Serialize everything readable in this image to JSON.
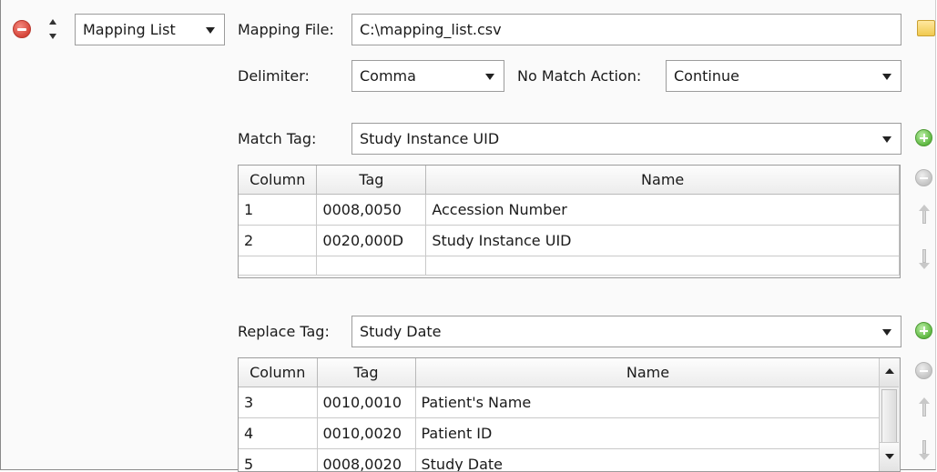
{
  "header": {
    "mode_select": {
      "value": "Mapping List"
    },
    "mapping_file_label": "Mapping File:",
    "mapping_file_value": "C:\\mapping_list.csv"
  },
  "delimiter": {
    "label": "Delimiter:",
    "value": "Comma",
    "no_match_label": "No Match Action:",
    "no_match_value": "Continue"
  },
  "match_tag": {
    "label": "Match Tag:",
    "value": "Study Instance UID",
    "table": {
      "columns": [
        "Column",
        "Tag",
        "Name"
      ],
      "rows": [
        [
          "1",
          "0008,0050",
          "Accession Number"
        ],
        [
          "2",
          "0020,000D",
          "Study Instance UID"
        ]
      ]
    }
  },
  "replace_tag": {
    "label": "Replace Tag:",
    "value": "Study Date",
    "table": {
      "columns": [
        "Column",
        "Tag",
        "Name"
      ],
      "rows": [
        [
          "3",
          "0010,0010",
          "Patient's Name"
        ],
        [
          "4",
          "0010,0020",
          "Patient ID"
        ],
        [
          "5",
          "0008,0020",
          "Study Date"
        ]
      ]
    }
  },
  "icons": {
    "remove_row": "remove-circle-icon",
    "reorder": "up-down-arrows-icon",
    "folder": "folder-icon",
    "add": "plus-circle-icon",
    "remove": "minus-circle-icon",
    "move_up": "arrow-up-icon",
    "move_down": "arrow-down-icon"
  },
  "colors": {
    "remove_red": "#d6463a",
    "add_green": "#5fb842"
  }
}
